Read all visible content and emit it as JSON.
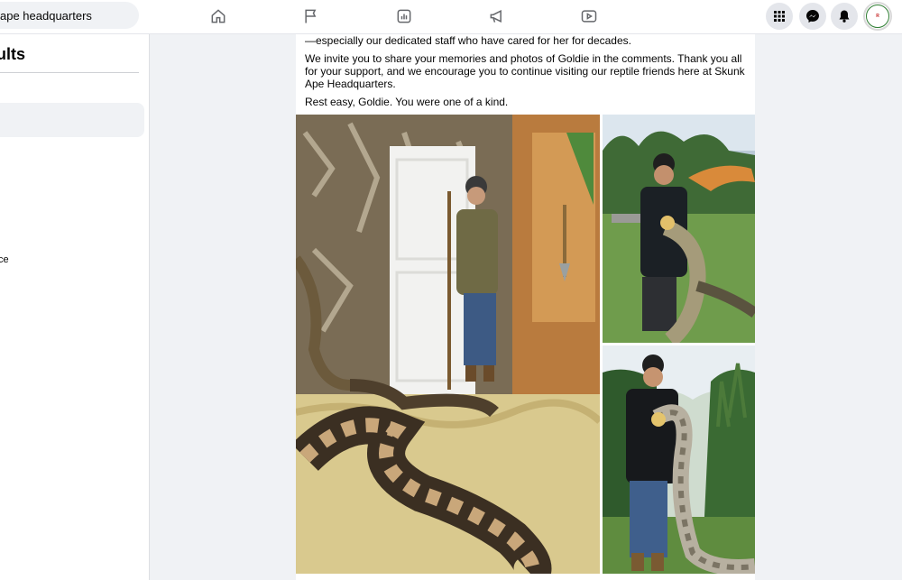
{
  "search": {
    "value": "ape headquarters"
  },
  "left_panel": {
    "title": "ults",
    "fragment": "ce"
  },
  "post": {
    "paragraphs": [
      "—especially our dedicated staff who have cared for her for decades.",
      "We invite you to share your memories and photos of Goldie in the comments. Thank you all for your support, and we encourage you to continue visiting our reptile friends here at Skunk Ape Headquarters.",
      "Rest easy, Goldie. You were one of a kind."
    ]
  },
  "avatar_text": "REPTILES",
  "nav_icons": [
    "home-icon",
    "flag-icon",
    "dashboard-icon",
    "megaphone-icon",
    "video-icon"
  ],
  "right_icons": [
    "menu-grid-icon",
    "messenger-icon",
    "bell-icon"
  ]
}
